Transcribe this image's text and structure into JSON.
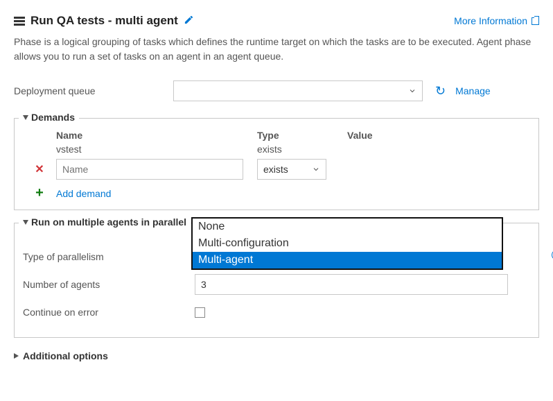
{
  "header": {
    "title": "Run QA tests - multi agent",
    "more_info": "More Information"
  },
  "description": "Phase is a logical grouping of tasks which defines the runtime target on which the tasks are to be executed. Agent phase allows you to run a set of tasks on an agent in an agent queue.",
  "queue": {
    "label": "Deployment queue",
    "selected": "",
    "manage": "Manage"
  },
  "demands": {
    "legend": "Demands",
    "headers": {
      "name": "Name",
      "type": "Type",
      "value": "Value"
    },
    "static": {
      "name": "vstest",
      "type": "exists",
      "value": ""
    },
    "editable": {
      "name_placeholder": "Name",
      "type": "exists",
      "value": ""
    },
    "add_label": "Add demand"
  },
  "parallel": {
    "legend": "Run on multiple agents in parallel",
    "type_label": "Type of parallelism",
    "dropdown": {
      "options": [
        "None",
        "Multi-configuration",
        "Multi-agent"
      ],
      "selected": "Multi-agent"
    },
    "agents_label": "Number of agents",
    "agents_value": "3",
    "continue_label": "Continue on error"
  },
  "additional": {
    "legend": "Additional options"
  }
}
